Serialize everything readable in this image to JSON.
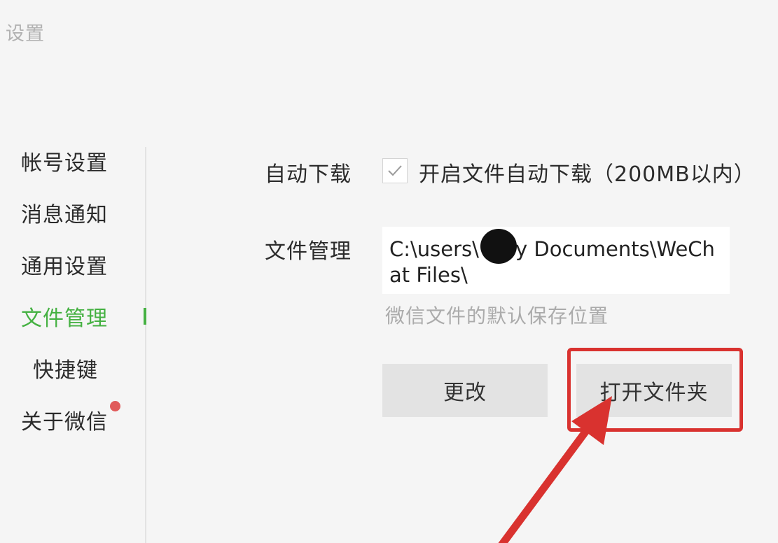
{
  "window": {
    "title": "设置"
  },
  "sidebar": {
    "items": [
      {
        "label": "帐号设置"
      },
      {
        "label": "消息通知"
      },
      {
        "label": "通用设置"
      },
      {
        "label": "文件管理",
        "active": true
      },
      {
        "label": "快捷键"
      },
      {
        "label": "关于微信",
        "has_badge": true
      }
    ]
  },
  "file_settings": {
    "auto_download": {
      "label": "自动下载",
      "checked": true,
      "option_text": "开启文件自动下载（200MB以内）"
    },
    "file_management": {
      "label": "文件管理",
      "path": "C:\\users\\   i\\My Documents\\WeChat Files\\",
      "hint": "微信文件的默认保存位置"
    },
    "buttons": {
      "change": "更改",
      "open_folder": "打开文件夹"
    }
  },
  "colors": {
    "accent_green": "#45b142",
    "badge_red": "#e05a5a",
    "annotation_red": "#d9322f"
  }
}
